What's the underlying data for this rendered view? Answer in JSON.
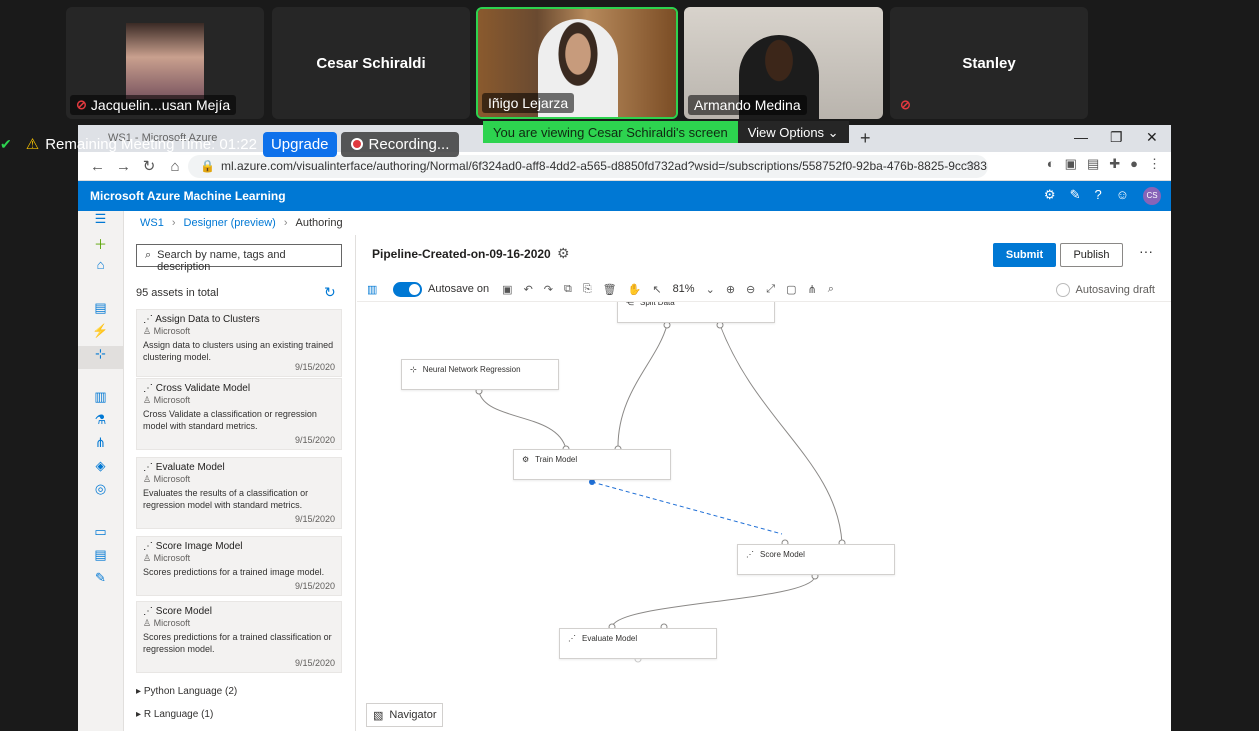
{
  "meeting": {
    "participants": [
      {
        "name": "Jacquelin...usan Mejía",
        "muted": true
      },
      {
        "name": "Cesar Schiraldi"
      },
      {
        "name": "Iñigo Lejarza",
        "active": true
      },
      {
        "name": "Armando Medina"
      },
      {
        "name": "Stanley",
        "muted": true
      }
    ],
    "remaining_time": "Remaining Meeting Time: 01:22",
    "upgrade_label": "Upgrade",
    "recording_label": "Recording...",
    "viewing_text": "You are viewing Cesar Schiraldi's screen",
    "view_options_label": "View Options"
  },
  "browser": {
    "tab_title": "WS1 - Microsoft Azure",
    "url": "ml.azure.com/visualinterface/authoring/Normal/6f324ad0-aff8-4dd2-a565-d8850fd732ad?wsid=/subscriptions/558752f0-92ba-476b-8825-9cc383..."
  },
  "app": {
    "title": "Microsoft Azure Machine Learning",
    "avatar_initials": "CS",
    "accent_color": "#0078d4"
  },
  "breadcrumb": {
    "ws": "WS1",
    "designer": "Designer (preview)",
    "current": "Authoring"
  },
  "assets": {
    "search_placeholder": "Search by name, tags and description",
    "count_label": "95 assets in total",
    "cards": [
      {
        "name": "Assign Data to Clusters",
        "vendor": "Microsoft",
        "desc": "Assign data to clusters using an existing trained clustering model.",
        "date": "9/15/2020"
      },
      {
        "name": "Cross Validate Model",
        "vendor": "Microsoft",
        "desc": "Cross Validate a classification or regression model with standard metrics.",
        "date": "9/15/2020"
      },
      {
        "name": "Evaluate Model",
        "vendor": "Microsoft",
        "desc": "Evaluates the results of a classification or regression model with standard metrics.",
        "date": "9/15/2020"
      },
      {
        "name": "Score Image Model",
        "vendor": "Microsoft",
        "desc": "Scores predictions for a trained image model.",
        "date": "9/15/2020"
      },
      {
        "name": "Score Model",
        "vendor": "Microsoft",
        "desc": "Scores predictions for a trained classification or regression model.",
        "date": "9/15/2020"
      }
    ],
    "categories": [
      "Python Language (2)",
      "R Language (1)"
    ]
  },
  "pipeline": {
    "title": "Pipeline-Created-on-09-16-2020",
    "submit_label": "Submit",
    "publish_label": "Publish",
    "autosave_label": "Autosave on",
    "zoom": "81%",
    "draft_status": "Autosaving draft",
    "navigator_label": "Navigator",
    "nodes": [
      {
        "id": "split",
        "label": "Split Data"
      },
      {
        "id": "nnr",
        "label": "Neural Network Regression"
      },
      {
        "id": "train",
        "label": "Train Model"
      },
      {
        "id": "score",
        "label": "Score Model"
      },
      {
        "id": "eval",
        "label": "Evaluate Model"
      }
    ]
  }
}
